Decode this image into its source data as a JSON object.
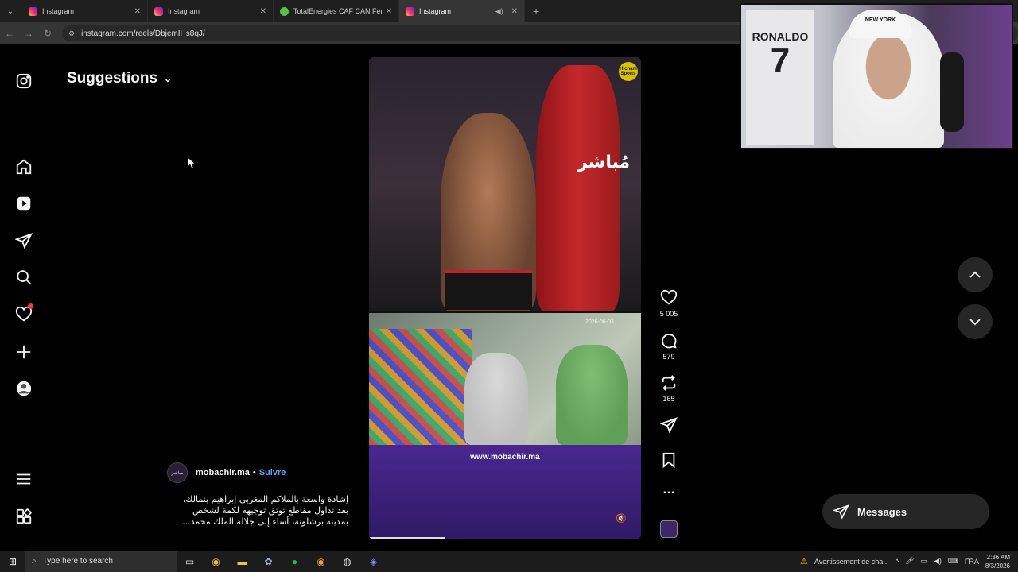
{
  "browser": {
    "tabs": [
      {
        "title": "Instagram",
        "favicon": "instagram-icon"
      },
      {
        "title": "Instagram",
        "favicon": "instagram-icon"
      },
      {
        "title": "TotalEnergies CAF CAN Fémini",
        "favicon": "green-favicon"
      },
      {
        "title": "Instagram",
        "favicon": "instagram-icon",
        "active": true
      }
    ],
    "close_glyph": "✕",
    "new_tab_glyph": "+",
    "url": "instagram.com/reels/DbjemIHs8qJ/"
  },
  "page": {
    "suggestions_label": "Suggestions",
    "chevron": "⌄"
  },
  "reel": {
    "overlay_text": "مُباشر",
    "badge_text": "Hicham Sports",
    "timestamp_overlay": "2026-06-03",
    "site_text": "www.mobachir.ma",
    "mute_glyph": "🔇",
    "progress": 0.28,
    "likes": "5 005",
    "comments": "579",
    "reposts": "165",
    "more_glyph": "…",
    "author": {
      "avatar_text": "مباشر",
      "username": "mobachir.ma",
      "separator": "•",
      "follow_label": "Suivre"
    },
    "caption_lines": [
      "إشادة واسعة بالملاكم المغربي إبراهيم بنمالك،",
      "بعد تداول مقاطع توثق توجيهه لكمة لشخص",
      "بمدينة برشلونة، أساء إلى جلالة الملك محمد..."
    ]
  },
  "right": {
    "messages_label": "Messages"
  },
  "webcam": {
    "jersey_name": "RONALDO",
    "jersey_number": "7",
    "cap_text": "NEW YORK"
  },
  "taskbar": {
    "search_placeholder": "Type here to search",
    "notification": "Avertissement de cha...",
    "language": "FRA",
    "time": "2:36 AM",
    "date": "8/3/2026"
  },
  "colors": {
    "accent_link": "#5aa0ff",
    "notification_dot": "#ff3040",
    "reel_banner": "#4a2790"
  }
}
